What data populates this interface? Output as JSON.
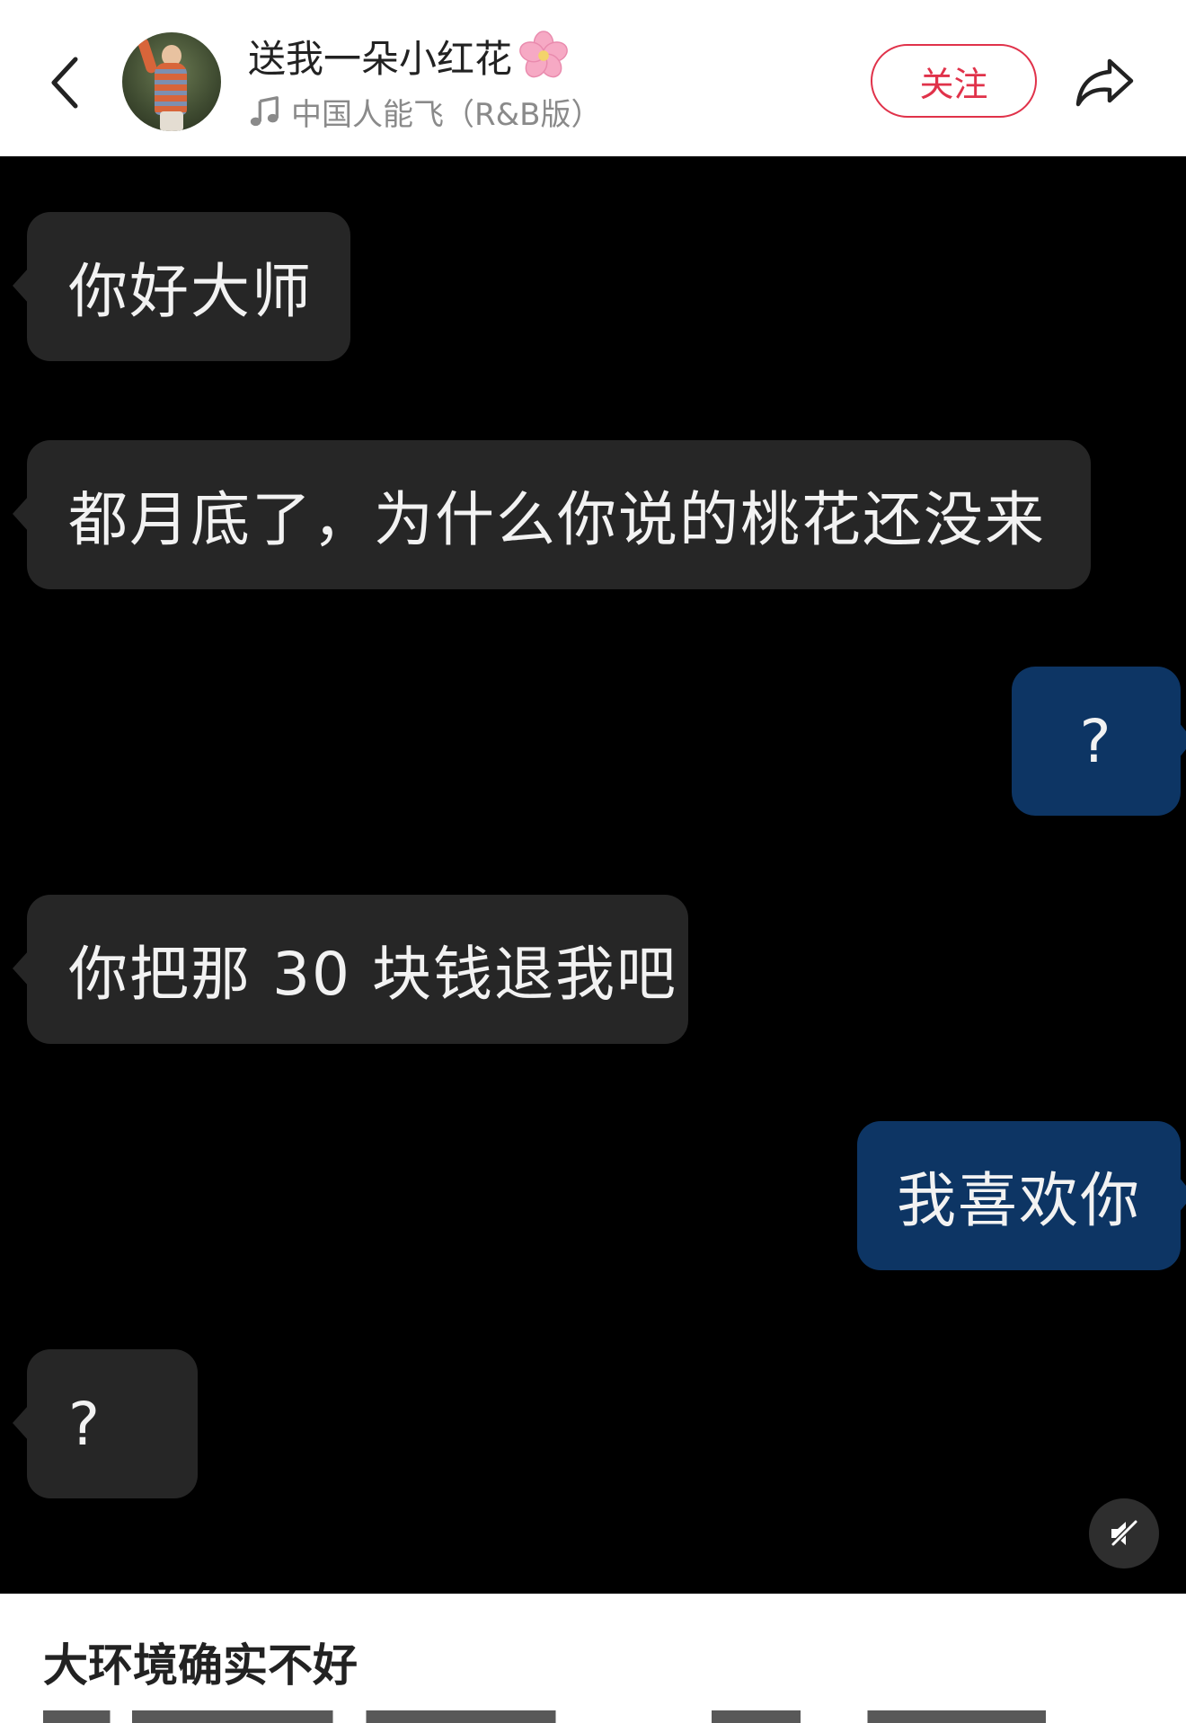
{
  "header": {
    "username": "送我一朵小红花",
    "name_emoji_icon": "cherry-blossom-icon",
    "music_icon": "music-note-icon",
    "music_title": "中国人能飞（R&B版）",
    "follow_label": "关注",
    "back_icon": "chevron-left-icon",
    "share_icon": "share-arrow-icon"
  },
  "chat": {
    "messages": [
      {
        "side": "left",
        "text": "你好大师"
      },
      {
        "side": "left",
        "text": "都月底了，为什么你说的桃花还没来"
      },
      {
        "side": "right",
        "text": "?"
      },
      {
        "side": "left",
        "text": "你把那 30 块钱退我吧"
      },
      {
        "side": "right",
        "text": "我喜欢你"
      },
      {
        "side": "left",
        "text": "?"
      }
    ],
    "mute_icon": "speaker-muted-icon"
  },
  "post": {
    "title": "大环境确实不好"
  },
  "colors": {
    "accent": "#e0324a",
    "left_bubble": "#262626",
    "right_bubble": "#0d3564",
    "media_bg": "#000000"
  }
}
